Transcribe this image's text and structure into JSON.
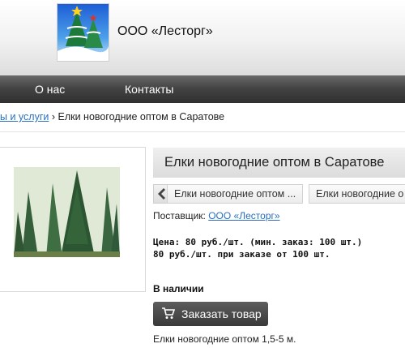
{
  "header": {
    "company_name": "ООО «Лесторг»",
    "logo_icon": "christmas-trees-logo"
  },
  "nav": {
    "items": [
      {
        "label": "О нас"
      },
      {
        "label": "Контакты"
      }
    ]
  },
  "breadcrumb": {
    "parent_link": "ы и услуги",
    "separator": "›",
    "current": "Елки новогодние оптом в Саратове"
  },
  "product": {
    "title": "Елки новогодние оптом в Саратове",
    "image_icon": "fir-trees-photo",
    "related_tabs": [
      {
        "label": "Елки новогодние оптом ..."
      },
      {
        "label": "Елки новогодние о"
      }
    ],
    "supplier_label": "Поставщик:",
    "supplier_name": "ООО «Лесторг»",
    "price_line1": "Цена: 80 руб./шт. (мин. заказ: 100 шт.)",
    "price_line2": "80 руб./шт. при заказе от 100 шт.",
    "availability": "В наличии",
    "order_button": "Заказать товар",
    "order_icon": "cart-icon",
    "description": "Елки новогодние оптом 1,5-5 м."
  }
}
